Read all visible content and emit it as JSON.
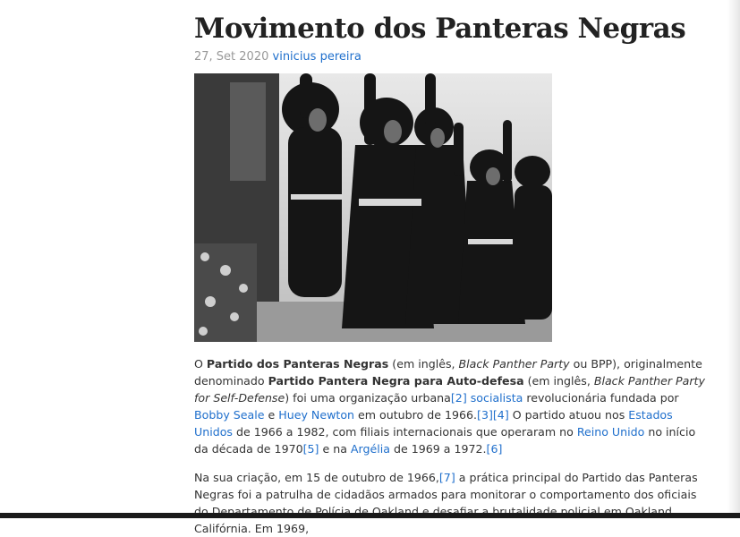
{
  "post": {
    "title": "Movimento dos Panteras Negras",
    "date": "27, Set 2020",
    "author": "vinicius pereira"
  },
  "photo": {
    "alt": "Foto em preto e branco de mulheres com punhos erguidos",
    "icon": "photo-image"
  },
  "paragraph1": {
    "t1": "O ",
    "b1": "Partido dos Panteras Negras",
    "t2": " (em inglês, ",
    "i1": "Black Panther Party",
    "t3": " ou BPP), originalmente denominado ",
    "b2": "Partido Pantera Negra para Auto-defesa",
    "t4": " (em inglês, ",
    "i2": "Black Panther Party for Self-Defense",
    "t5": ") foi uma organização urbana",
    "ref2": "[2]",
    "t6": " ",
    "link_socialista": "socialista",
    "t7": " revolucionária fundada por ",
    "link_bobby": "Bobby Seale",
    "t8": " e ",
    "link_huey": "Huey Newton",
    "t9": " em outubro de 1966.",
    "ref3": "[3]",
    "ref4": "[4]",
    "t10": " O partido atuou nos ",
    "link_eua": "Estados Unidos",
    "t11": " de 1966 a 1982, com filiais internacionais que operaram no ",
    "link_reino": "Reino Unido",
    "t12": " no início da década de 1970",
    "ref5": "[5]",
    "t13": " e na ",
    "link_argelia": "Argélia",
    "t14": " de 1969 a 1972.",
    "ref6": "[6]"
  },
  "paragraph2": {
    "t1": "Na sua criação, em 15 de outubro de 1966,",
    "ref7": "[7]",
    "t2": " a prática principal do Partido das Panteras Negras foi a patrulha de cidadãos armados para monitorar o comportamento dos oficiais do Departamento de Polícia de Oakland e desafiar a brutalidade policial em Oakland, Califórnia. Em 1969,"
  },
  "colors": {
    "link": "#1f6fcc",
    "text": "#333333",
    "title": "#222222",
    "meta": "#999999"
  }
}
